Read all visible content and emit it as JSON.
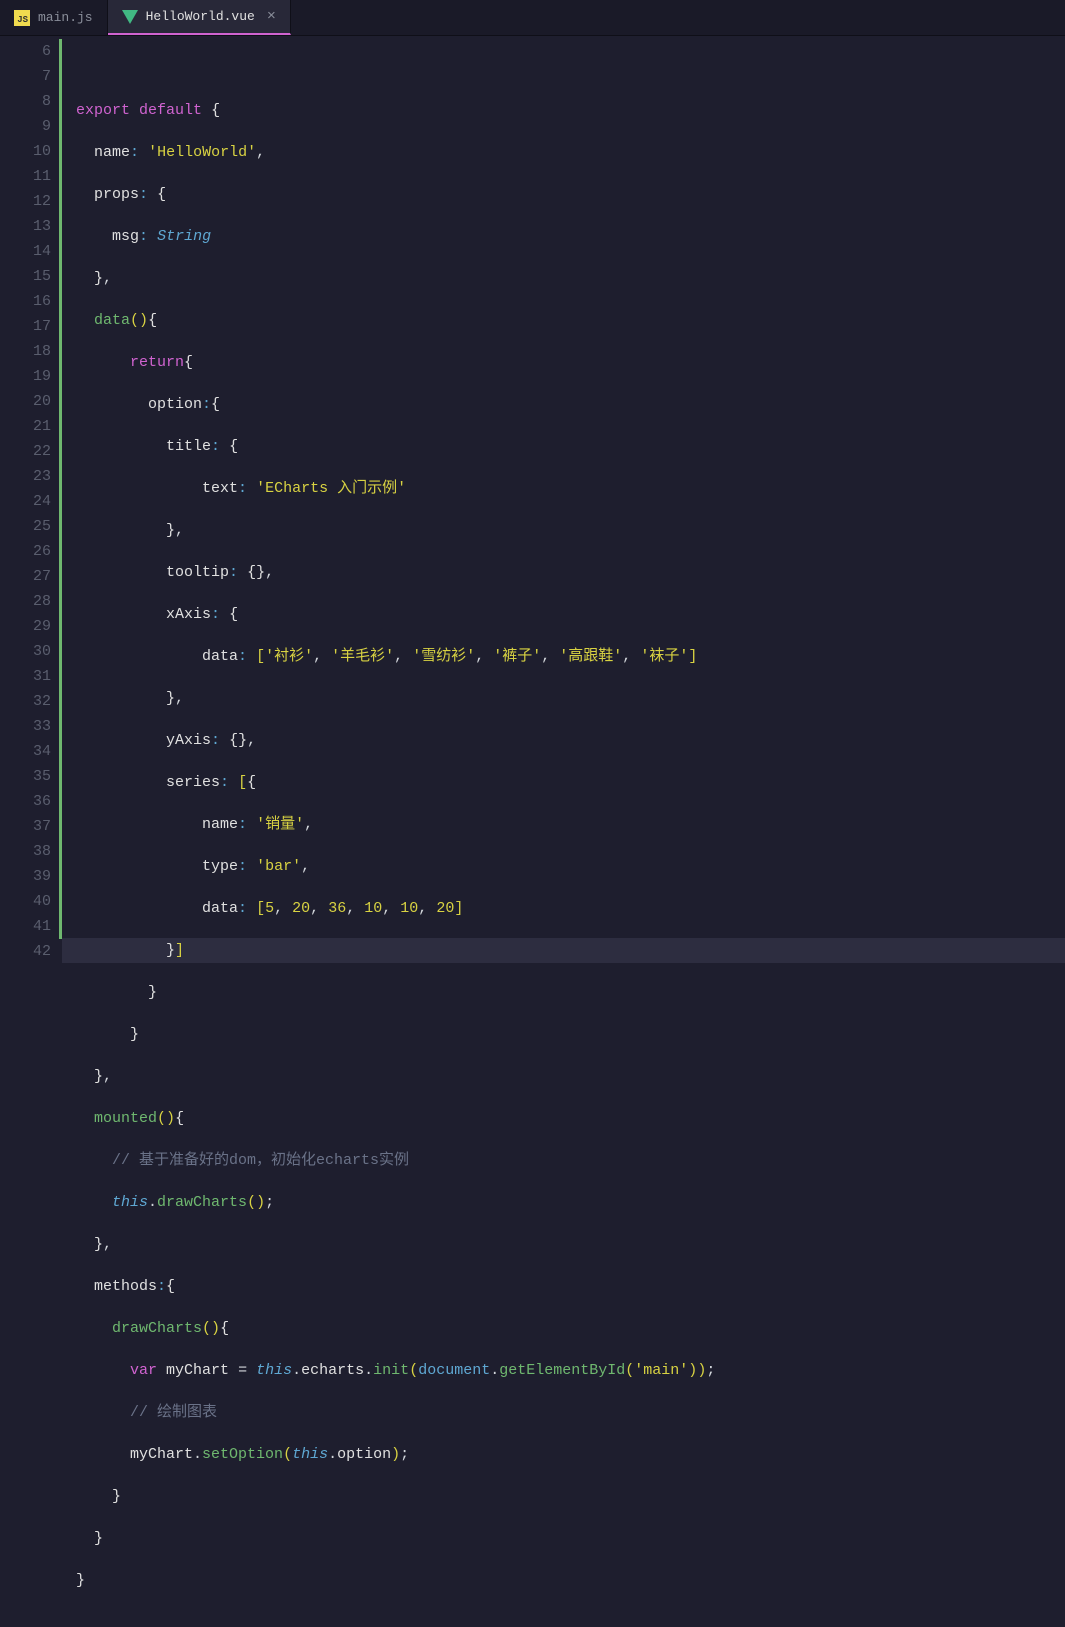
{
  "tabs": [
    {
      "label": "main.js",
      "icon": "js",
      "active": false
    },
    {
      "label": "HelloWorld.vue",
      "icon": "vue",
      "active": true
    }
  ],
  "gutter": {
    "start": 6,
    "end": 42,
    "modified": [
      6,
      7,
      8,
      9,
      10,
      11,
      12,
      13,
      14,
      15,
      16,
      17,
      18,
      19,
      20,
      21,
      22,
      23,
      24,
      25,
      26,
      27,
      28,
      29,
      30,
      31,
      32,
      33,
      34,
      35,
      36,
      37,
      38,
      39,
      40,
      41
    ]
  },
  "highlight_line": 27,
  "code_tokens": {
    "export": "export",
    "default": "default",
    "return": "return",
    "var": "var",
    "this": "this",
    "String": "String",
    "name": "name",
    "props": "props",
    "msg": "msg",
    "data_fn": "data",
    "option": "option",
    "title": "title",
    "text": "text",
    "tooltip": "tooltip",
    "xAxis": "xAxis",
    "data_key": "data",
    "yAxis": "yAxis",
    "series": "series",
    "name_key": "name",
    "type_key": "type",
    "mounted": "mounted",
    "methods": "methods",
    "drawCharts": "drawCharts",
    "myChart": "myChart",
    "echarts": "echarts",
    "init": "init",
    "document": "document",
    "getElementById": "getElementById",
    "setOption": "setOption",
    "str_HelloWorld": "'HelloWorld'",
    "str_echarts_title": "'ECharts 入门示例'",
    "str_shanshan": "'衬衫'",
    "str_yangmao": "'羊毛衫'",
    "str_xuefang": "'雪纺衫'",
    "str_kuzi": "'裤子'",
    "str_gaogen": "'高跟鞋'",
    "str_wazi": "'袜子'",
    "str_xiaoliang": "'销量'",
    "str_bar": "'bar'",
    "str_main": "'main'",
    "num_5": "5",
    "num_20": "20",
    "num_36": "36",
    "num_10": "10",
    "comment_dom": "// 基于准备好的dom，初始化echarts实例",
    "comment_draw": "// 绘制图表"
  }
}
